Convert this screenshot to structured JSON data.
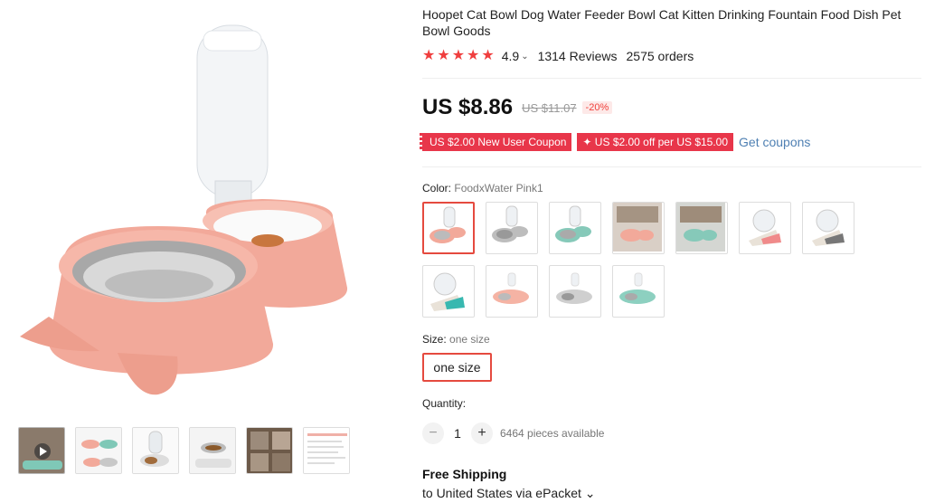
{
  "product": {
    "title": "Hoopet Cat Bowl Dog Water Feeder Bowl Cat Kitten Drinking Fountain Food Dish Pet Bowl Goods",
    "rating": "4.9",
    "rating_chevron": "⌄",
    "reviews": "1314 Reviews",
    "orders": "2575 orders",
    "star_count": 5,
    "price": "US $8.86",
    "old_price": "US $11.07",
    "discount": "-20%",
    "coupons": [
      "US $2.00 New User Coupon",
      "✦ US $2.00 off per US $15.00"
    ],
    "get_coupons": "Get coupons",
    "color_label": "Color:",
    "color_value": "FoodxWater Pink1",
    "swatch_count": 11,
    "size_label": "Size:",
    "size_value": "one size",
    "size_option": "one size",
    "quantity_label": "Quantity:",
    "qty_minus": "−",
    "qty_plus": "+",
    "quantity": "1",
    "available": "6464 pieces available",
    "shipping_title": "Free Shipping",
    "shipping_dest": "to United States via ePacket ⌄"
  },
  "colors": {
    "accent": "#e54a3f",
    "coupon": "#e8364a",
    "link": "#4f80b3",
    "bowl": "#f2a99a"
  }
}
